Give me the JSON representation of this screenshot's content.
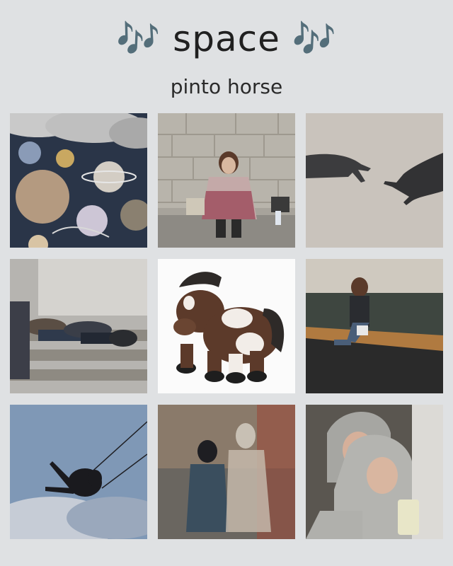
{
  "header": {
    "title": "🎶 space 🎶",
    "subtitle": "pinto horse"
  },
  "tiles": [
    {
      "icon": "planets-collage-image"
    },
    {
      "icon": "girl-sitting-on-steps-image"
    },
    {
      "icon": "reaching-hands-shadow-image"
    },
    {
      "icon": "people-lying-on-stairs-image"
    },
    {
      "icon": "pinto-horse-plush-image"
    },
    {
      "icon": "woman-on-bench-image"
    },
    {
      "icon": "swing-silhouette-image"
    },
    {
      "icon": "painting-two-figures-image"
    },
    {
      "icon": "hoodie-mirror-selfie-image"
    }
  ]
}
